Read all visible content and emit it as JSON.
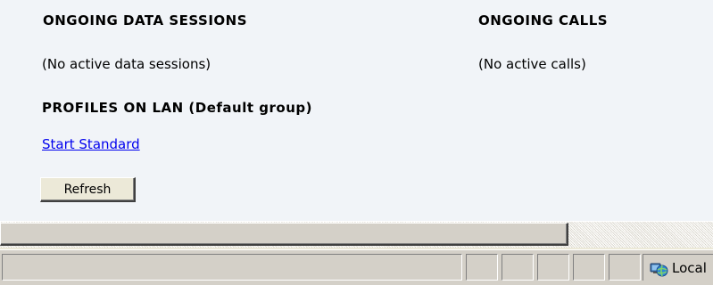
{
  "sections": {
    "data_sessions": {
      "heading": "ONGOING DATA SESSIONS",
      "empty_text": "(No active data sessions)"
    },
    "calls": {
      "heading": "ONGOING CALLS",
      "empty_text": "(No active calls)"
    },
    "profiles": {
      "heading": "PROFILES ON LAN (Default group)",
      "link_label": "Start Standard"
    }
  },
  "actions": {
    "refresh_label": "Refresh"
  },
  "statusbar": {
    "zone_label": "Local",
    "zone_icon": "local-intranet-icon"
  },
  "colors": {
    "link": "#0000ee",
    "background": "#f1f4f8",
    "chrome": "#d4d0c8"
  }
}
